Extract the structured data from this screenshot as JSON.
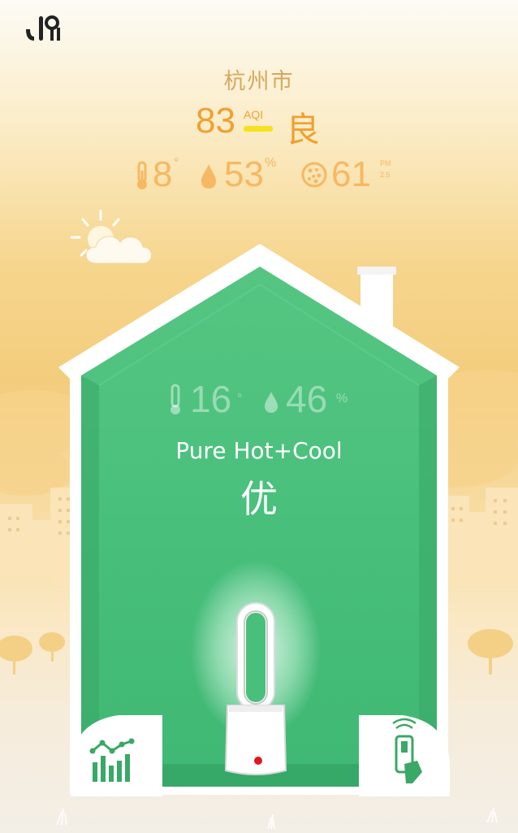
{
  "outdoor": {
    "city": "杭州市",
    "aqi_value": "83",
    "aqi_label": "AQI",
    "aqi_grade": "良",
    "temperature": "8",
    "temperature_unit": "°",
    "humidity": "53",
    "humidity_unit": "%",
    "pm_value": "61",
    "pm_unit_top": "PM",
    "pm_unit_bottom": "2.5",
    "weather_icon": "partly-cloudy-icon"
  },
  "indoor": {
    "temperature": "16",
    "temperature_unit": "°",
    "humidity": "46",
    "humidity_unit": "%",
    "device_name": "Pure Hot+Cool",
    "air_grade": "优"
  },
  "controls": {
    "stats_icon": "chart-icon",
    "remote_icon": "remote-control-icon",
    "logo_icon": "app-logo-icon"
  },
  "colors": {
    "accent_orange": "#f0a030",
    "aqi_bar": "#f7e11e",
    "house_green": "#4fc77f",
    "house_wall": "#ffffff",
    "status_dot": "#e0181b"
  }
}
